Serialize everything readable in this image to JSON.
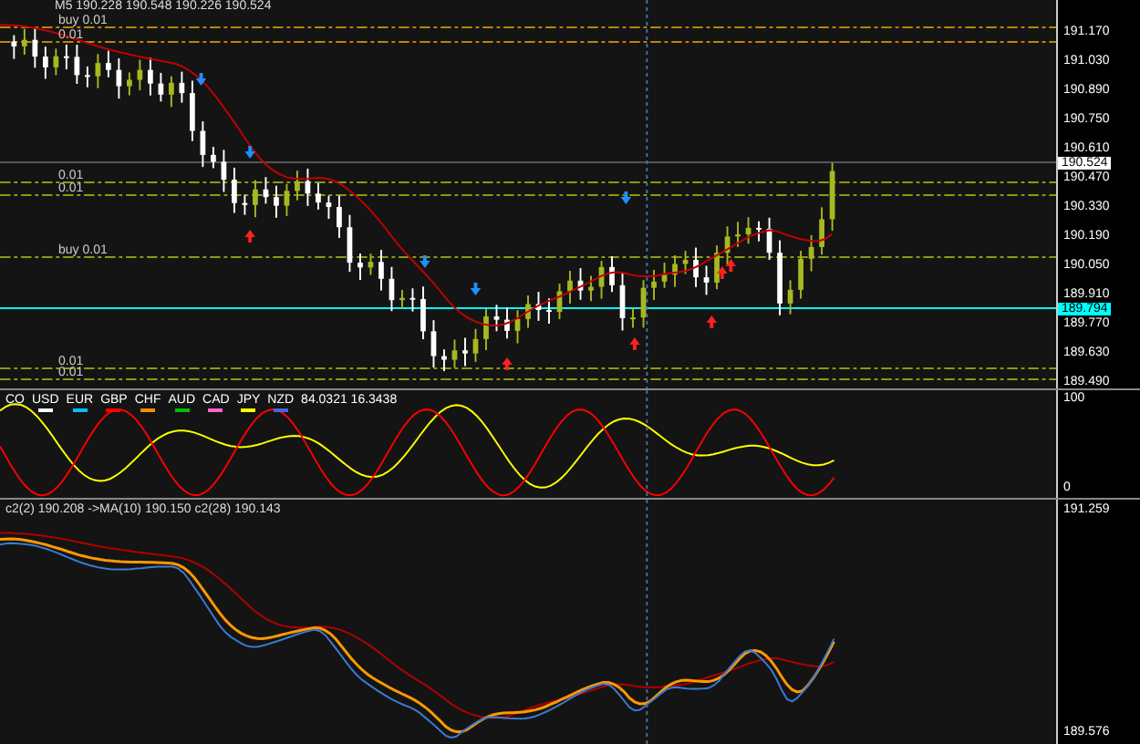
{
  "main_pane": {
    "header": "M5  190.228 190.548 190.226 190.524",
    "order_labels": [
      "buy 0.01",
      "0.01",
      "0.01",
      "0.01",
      "buy 0.01",
      "0.01",
      "0.01"
    ],
    "axis_ticks": [
      "191.170",
      "191.030",
      "190.890",
      "190.750",
      "190.610",
      "190.470",
      "190.330",
      "190.190",
      "190.050",
      "189.910",
      "189.770",
      "189.630",
      "189.490"
    ],
    "price_tags": [
      {
        "text": "190.524",
        "kind": "bid"
      },
      {
        "text": "189.794",
        "kind": "line"
      }
    ]
  },
  "indicator_pane": {
    "name": "CO",
    "currencies": [
      {
        "code": "USD",
        "color": "#ffffff"
      },
      {
        "code": "EUR",
        "color": "#00bfff"
      },
      {
        "code": "GBP",
        "color": "#ff0000"
      },
      {
        "code": "CHF",
        "color": "#ff8c00"
      },
      {
        "code": "AUD",
        "color": "#00c000"
      },
      {
        "code": "CAD",
        "color": "#ff66cc"
      },
      {
        "code": "JPY",
        "color": "#ffff00"
      },
      {
        "code": "NZD",
        "color": "#4169e1"
      }
    ],
    "values": "84.0321 16.3438",
    "axis_ticks": [
      "100",
      "0"
    ]
  },
  "ma_pane": {
    "legend": "c2(2) 190.208  ->MA(10) 190.150  c2(28) 190.143",
    "axis_ticks": [
      "191.259",
      "189.576"
    ]
  }
}
